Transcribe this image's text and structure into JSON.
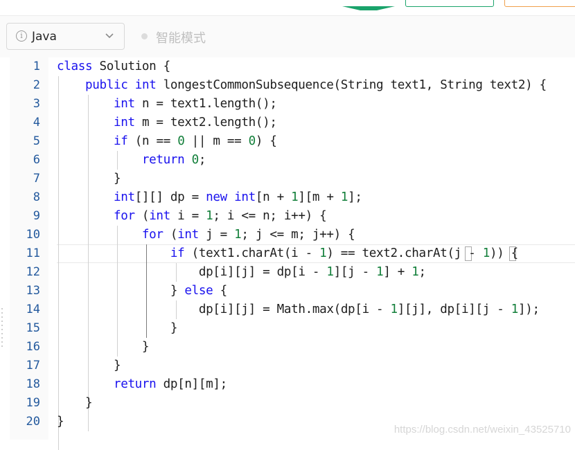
{
  "toolbar": {
    "language": "Java",
    "mode_label": "智能模式",
    "icons": {
      "info": "info-circle-icon",
      "chevron": "chevron-down-icon",
      "mode_dot": "dot-icon"
    }
  },
  "editor": {
    "line_numbers": [
      "1",
      "2",
      "3",
      "4",
      "5",
      "6",
      "7",
      "8",
      "9",
      "10",
      "11",
      "12",
      "13",
      "14",
      "15",
      "16",
      "17",
      "18",
      "19",
      "20"
    ],
    "current_line": "11",
    "lines": [
      "class Solution {",
      "    public int longestCommonSubsequence(String text1, String text2) {",
      "        int n = text1.length();",
      "        int m = text2.length();",
      "        if (n == 0 || m == 0) {",
      "            return 0;",
      "        }",
      "        int[][] dp = new int[n + 1][m + 1];",
      "        for (int i = 1; i <= n; i++) {",
      "            for (int j = 1; j <= m; j++) {",
      "                if (text1.charAt(i - 1) == text2.charAt(j - 1)) {",
      "                    dp[i][j] = dp[i - 1][j - 1] + 1;",
      "                } else {",
      "                    dp[i][j] = Math.max(dp[i - 1][j], dp[i][j - 1]);",
      "                }",
      "            }",
      "        }",
      "        return dp[n][m];",
      "    }",
      "}"
    ]
  },
  "watermark": "https://blog.csdn.net/weixin_43525710",
  "colors": {
    "keyword": "#1a12ee",
    "number": "#127f3a",
    "line_number": "#23599d",
    "text": "#1e1e1e"
  }
}
